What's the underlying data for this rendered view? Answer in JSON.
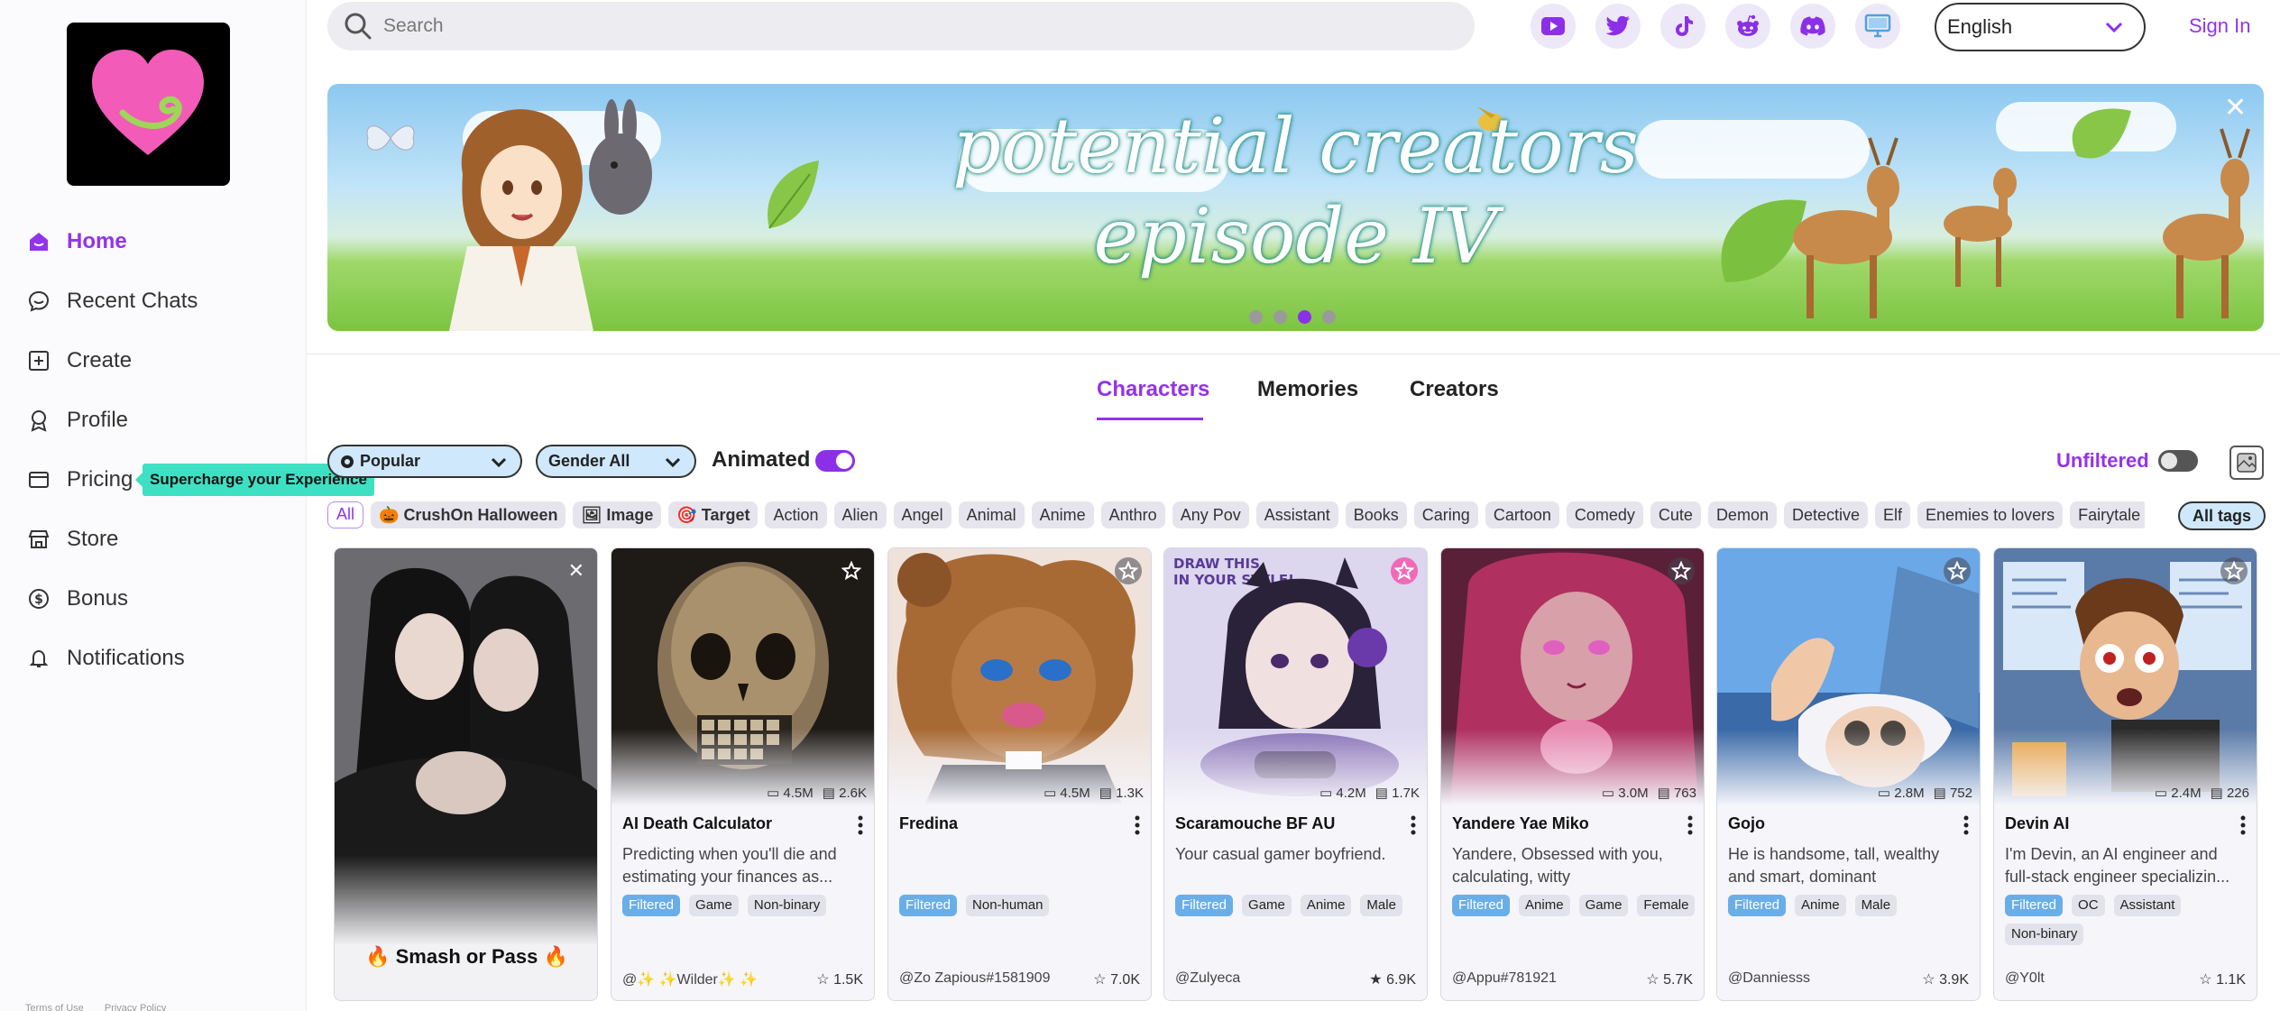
{
  "sidebar": {
    "nav": [
      {
        "label": "Home",
        "icon": "home-icon",
        "active": true
      },
      {
        "label": "Recent Chats",
        "icon": "chat-bubble-icon"
      },
      {
        "label": "Create",
        "icon": "plus-square-icon"
      },
      {
        "label": "Profile",
        "icon": "profile-badge-icon"
      },
      {
        "label": "Pricing",
        "icon": "pricing-card-icon"
      },
      {
        "label": "Store",
        "icon": "store-icon"
      },
      {
        "label": "Bonus",
        "icon": "dollar-coin-icon"
      },
      {
        "label": "Notifications",
        "icon": "bell-icon"
      }
    ],
    "pricing_tooltip": "Supercharge your Experience",
    "footer": {
      "terms": "Terms of Use",
      "privacy": "Privacy Policy"
    }
  },
  "header": {
    "search_placeholder": "Search",
    "social": [
      "youtube-icon",
      "twitter-icon",
      "tiktok-icon",
      "reddit-icon",
      "discord-icon",
      "desktop-icon"
    ],
    "language": "English",
    "sign_in": "Sign In"
  },
  "banner": {
    "line1": "potential creators",
    "line2": "episode IV",
    "active_slide": 3,
    "slide_count": 4
  },
  "tabs": [
    {
      "label": "Characters",
      "active": true
    },
    {
      "label": "Memories"
    },
    {
      "label": "Creators"
    }
  ],
  "filters": {
    "sort": "Popular",
    "gender": "Gender All",
    "animated_label": "Animated",
    "animated_on": true,
    "unfiltered_label": "Unfiltered",
    "unfiltered_on": false
  },
  "tags": [
    "All",
    "CrushOn Halloween",
    "Image",
    "Target",
    "Action",
    "Alien",
    "Angel",
    "Animal",
    "Anime",
    "Anthro",
    "Any Pov",
    "Assistant",
    "Books",
    "Caring",
    "Cartoon",
    "Comedy",
    "Cute",
    "Demon",
    "Detective",
    "Elf",
    "Enemies to lovers",
    "Fairytale"
  ],
  "all_tags_label": "All tags",
  "cards": [
    {
      "smash": "Smash or Pass"
    },
    {
      "name": "AI Death Calculator",
      "chats": "4.5M",
      "msgs": "2.6K",
      "desc": "Predicting when you'll die and estimating your finances as...",
      "tags": [
        "Filtered",
        "Game",
        "Non-binary"
      ],
      "author": "@✨ ✨Wilder✨ ✨",
      "likes": "1.5K"
    },
    {
      "name": "Fredina",
      "chats": "4.5M",
      "msgs": "1.3K",
      "desc": "",
      "tags": [
        "Filtered",
        "Non-human"
      ],
      "author": "@Zo Zapious#1581909",
      "likes": "7.0K"
    },
    {
      "name": "Scaramouche BF AU",
      "chats": "4.2M",
      "msgs": "1.7K",
      "desc": "Your casual gamer boyfriend.",
      "tags": [
        "Filtered",
        "Game",
        "Anime",
        "Male"
      ],
      "author": "@Zulyeca",
      "likes": "6.9K"
    },
    {
      "name": "Yandere Yae Miko",
      "chats": "3.0M",
      "msgs": "763",
      "desc": "Yandere, Obsessed with you, calculating, witty",
      "tags": [
        "Filtered",
        "Anime",
        "Game",
        "Female"
      ],
      "author": "@Appu#781921",
      "likes": "5.7K"
    },
    {
      "name": "Gojo",
      "chats": "2.8M",
      "msgs": "752",
      "desc": "He is handsome, tall, wealthy and smart, dominant",
      "tags": [
        "Filtered",
        "Anime",
        "Male"
      ],
      "author": "@Danniesss",
      "likes": "3.9K"
    },
    {
      "name": "Devin AI",
      "chats": "2.4M",
      "msgs": "226",
      "desc": "I'm Devin, an AI engineer and full-stack engineer specializin...",
      "tags": [
        "Filtered",
        "OC",
        "Assistant",
        "Non-binary"
      ],
      "author": "@Y0lt",
      "likes": "1.1K"
    }
  ]
}
